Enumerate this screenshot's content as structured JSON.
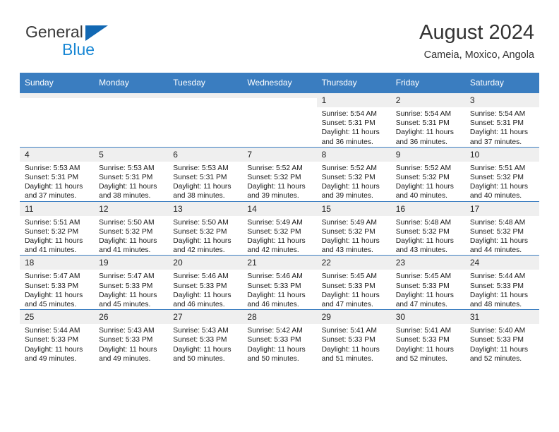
{
  "brand": {
    "name_part1": "General",
    "name_part2": "Blue",
    "accent_color": "#1268b3",
    "text_color": "#1887d4"
  },
  "header": {
    "title": "August 2024",
    "subtitle": "Cameia, Moxico, Angola",
    "header_bg": "#3a7dc0"
  },
  "weekdays": [
    "Sunday",
    "Monday",
    "Tuesday",
    "Wednesday",
    "Thursday",
    "Friday",
    "Saturday"
  ],
  "labels": {
    "sunrise_prefix": "Sunrise:",
    "sunset_prefix": "Sunset:",
    "daylight_prefix": "Daylight:"
  },
  "weeks": [
    [
      {
        "day": "",
        "line1": "",
        "line2": "",
        "line3": "",
        "line4": "",
        "empty": true
      },
      {
        "day": "",
        "line1": "",
        "line2": "",
        "line3": "",
        "line4": "",
        "empty": true
      },
      {
        "day": "",
        "line1": "",
        "line2": "",
        "line3": "",
        "line4": "",
        "empty": true
      },
      {
        "day": "",
        "line1": "",
        "line2": "",
        "line3": "",
        "line4": "",
        "empty": true
      },
      {
        "day": "1",
        "line1": "Sunrise: 5:54 AM",
        "line2": "Sunset: 5:31 PM",
        "line3": "Daylight: 11 hours",
        "line4": "and 36 minutes."
      },
      {
        "day": "2",
        "line1": "Sunrise: 5:54 AM",
        "line2": "Sunset: 5:31 PM",
        "line3": "Daylight: 11 hours",
        "line4": "and 36 minutes."
      },
      {
        "day": "3",
        "line1": "Sunrise: 5:54 AM",
        "line2": "Sunset: 5:31 PM",
        "line3": "Daylight: 11 hours",
        "line4": "and 37 minutes."
      }
    ],
    [
      {
        "day": "4",
        "line1": "Sunrise: 5:53 AM",
        "line2": "Sunset: 5:31 PM",
        "line3": "Daylight: 11 hours",
        "line4": "and 37 minutes."
      },
      {
        "day": "5",
        "line1": "Sunrise: 5:53 AM",
        "line2": "Sunset: 5:31 PM",
        "line3": "Daylight: 11 hours",
        "line4": "and 38 minutes."
      },
      {
        "day": "6",
        "line1": "Sunrise: 5:53 AM",
        "line2": "Sunset: 5:31 PM",
        "line3": "Daylight: 11 hours",
        "line4": "and 38 minutes."
      },
      {
        "day": "7",
        "line1": "Sunrise: 5:52 AM",
        "line2": "Sunset: 5:32 PM",
        "line3": "Daylight: 11 hours",
        "line4": "and 39 minutes."
      },
      {
        "day": "8",
        "line1": "Sunrise: 5:52 AM",
        "line2": "Sunset: 5:32 PM",
        "line3": "Daylight: 11 hours",
        "line4": "and 39 minutes."
      },
      {
        "day": "9",
        "line1": "Sunrise: 5:52 AM",
        "line2": "Sunset: 5:32 PM",
        "line3": "Daylight: 11 hours",
        "line4": "and 40 minutes."
      },
      {
        "day": "10",
        "line1": "Sunrise: 5:51 AM",
        "line2": "Sunset: 5:32 PM",
        "line3": "Daylight: 11 hours",
        "line4": "and 40 minutes."
      }
    ],
    [
      {
        "day": "11",
        "line1": "Sunrise: 5:51 AM",
        "line2": "Sunset: 5:32 PM",
        "line3": "Daylight: 11 hours",
        "line4": "and 41 minutes."
      },
      {
        "day": "12",
        "line1": "Sunrise: 5:50 AM",
        "line2": "Sunset: 5:32 PM",
        "line3": "Daylight: 11 hours",
        "line4": "and 41 minutes."
      },
      {
        "day": "13",
        "line1": "Sunrise: 5:50 AM",
        "line2": "Sunset: 5:32 PM",
        "line3": "Daylight: 11 hours",
        "line4": "and 42 minutes."
      },
      {
        "day": "14",
        "line1": "Sunrise: 5:49 AM",
        "line2": "Sunset: 5:32 PM",
        "line3": "Daylight: 11 hours",
        "line4": "and 42 minutes."
      },
      {
        "day": "15",
        "line1": "Sunrise: 5:49 AM",
        "line2": "Sunset: 5:32 PM",
        "line3": "Daylight: 11 hours",
        "line4": "and 43 minutes."
      },
      {
        "day": "16",
        "line1": "Sunrise: 5:48 AM",
        "line2": "Sunset: 5:32 PM",
        "line3": "Daylight: 11 hours",
        "line4": "and 43 minutes."
      },
      {
        "day": "17",
        "line1": "Sunrise: 5:48 AM",
        "line2": "Sunset: 5:32 PM",
        "line3": "Daylight: 11 hours",
        "line4": "and 44 minutes."
      }
    ],
    [
      {
        "day": "18",
        "line1": "Sunrise: 5:47 AM",
        "line2": "Sunset: 5:33 PM",
        "line3": "Daylight: 11 hours",
        "line4": "and 45 minutes."
      },
      {
        "day": "19",
        "line1": "Sunrise: 5:47 AM",
        "line2": "Sunset: 5:33 PM",
        "line3": "Daylight: 11 hours",
        "line4": "and 45 minutes."
      },
      {
        "day": "20",
        "line1": "Sunrise: 5:46 AM",
        "line2": "Sunset: 5:33 PM",
        "line3": "Daylight: 11 hours",
        "line4": "and 46 minutes."
      },
      {
        "day": "21",
        "line1": "Sunrise: 5:46 AM",
        "line2": "Sunset: 5:33 PM",
        "line3": "Daylight: 11 hours",
        "line4": "and 46 minutes."
      },
      {
        "day": "22",
        "line1": "Sunrise: 5:45 AM",
        "line2": "Sunset: 5:33 PM",
        "line3": "Daylight: 11 hours",
        "line4": "and 47 minutes."
      },
      {
        "day": "23",
        "line1": "Sunrise: 5:45 AM",
        "line2": "Sunset: 5:33 PM",
        "line3": "Daylight: 11 hours",
        "line4": "and 47 minutes."
      },
      {
        "day": "24",
        "line1": "Sunrise: 5:44 AM",
        "line2": "Sunset: 5:33 PM",
        "line3": "Daylight: 11 hours",
        "line4": "and 48 minutes."
      }
    ],
    [
      {
        "day": "25",
        "line1": "Sunrise: 5:44 AM",
        "line2": "Sunset: 5:33 PM",
        "line3": "Daylight: 11 hours",
        "line4": "and 49 minutes."
      },
      {
        "day": "26",
        "line1": "Sunrise: 5:43 AM",
        "line2": "Sunset: 5:33 PM",
        "line3": "Daylight: 11 hours",
        "line4": "and 49 minutes."
      },
      {
        "day": "27",
        "line1": "Sunrise: 5:43 AM",
        "line2": "Sunset: 5:33 PM",
        "line3": "Daylight: 11 hours",
        "line4": "and 50 minutes."
      },
      {
        "day": "28",
        "line1": "Sunrise: 5:42 AM",
        "line2": "Sunset: 5:33 PM",
        "line3": "Daylight: 11 hours",
        "line4": "and 50 minutes."
      },
      {
        "day": "29",
        "line1": "Sunrise: 5:41 AM",
        "line2": "Sunset: 5:33 PM",
        "line3": "Daylight: 11 hours",
        "line4": "and 51 minutes."
      },
      {
        "day": "30",
        "line1": "Sunrise: 5:41 AM",
        "line2": "Sunset: 5:33 PM",
        "line3": "Daylight: 11 hours",
        "line4": "and 52 minutes."
      },
      {
        "day": "31",
        "line1": "Sunrise: 5:40 AM",
        "line2": "Sunset: 5:33 PM",
        "line3": "Daylight: 11 hours",
        "line4": "and 52 minutes."
      }
    ]
  ]
}
